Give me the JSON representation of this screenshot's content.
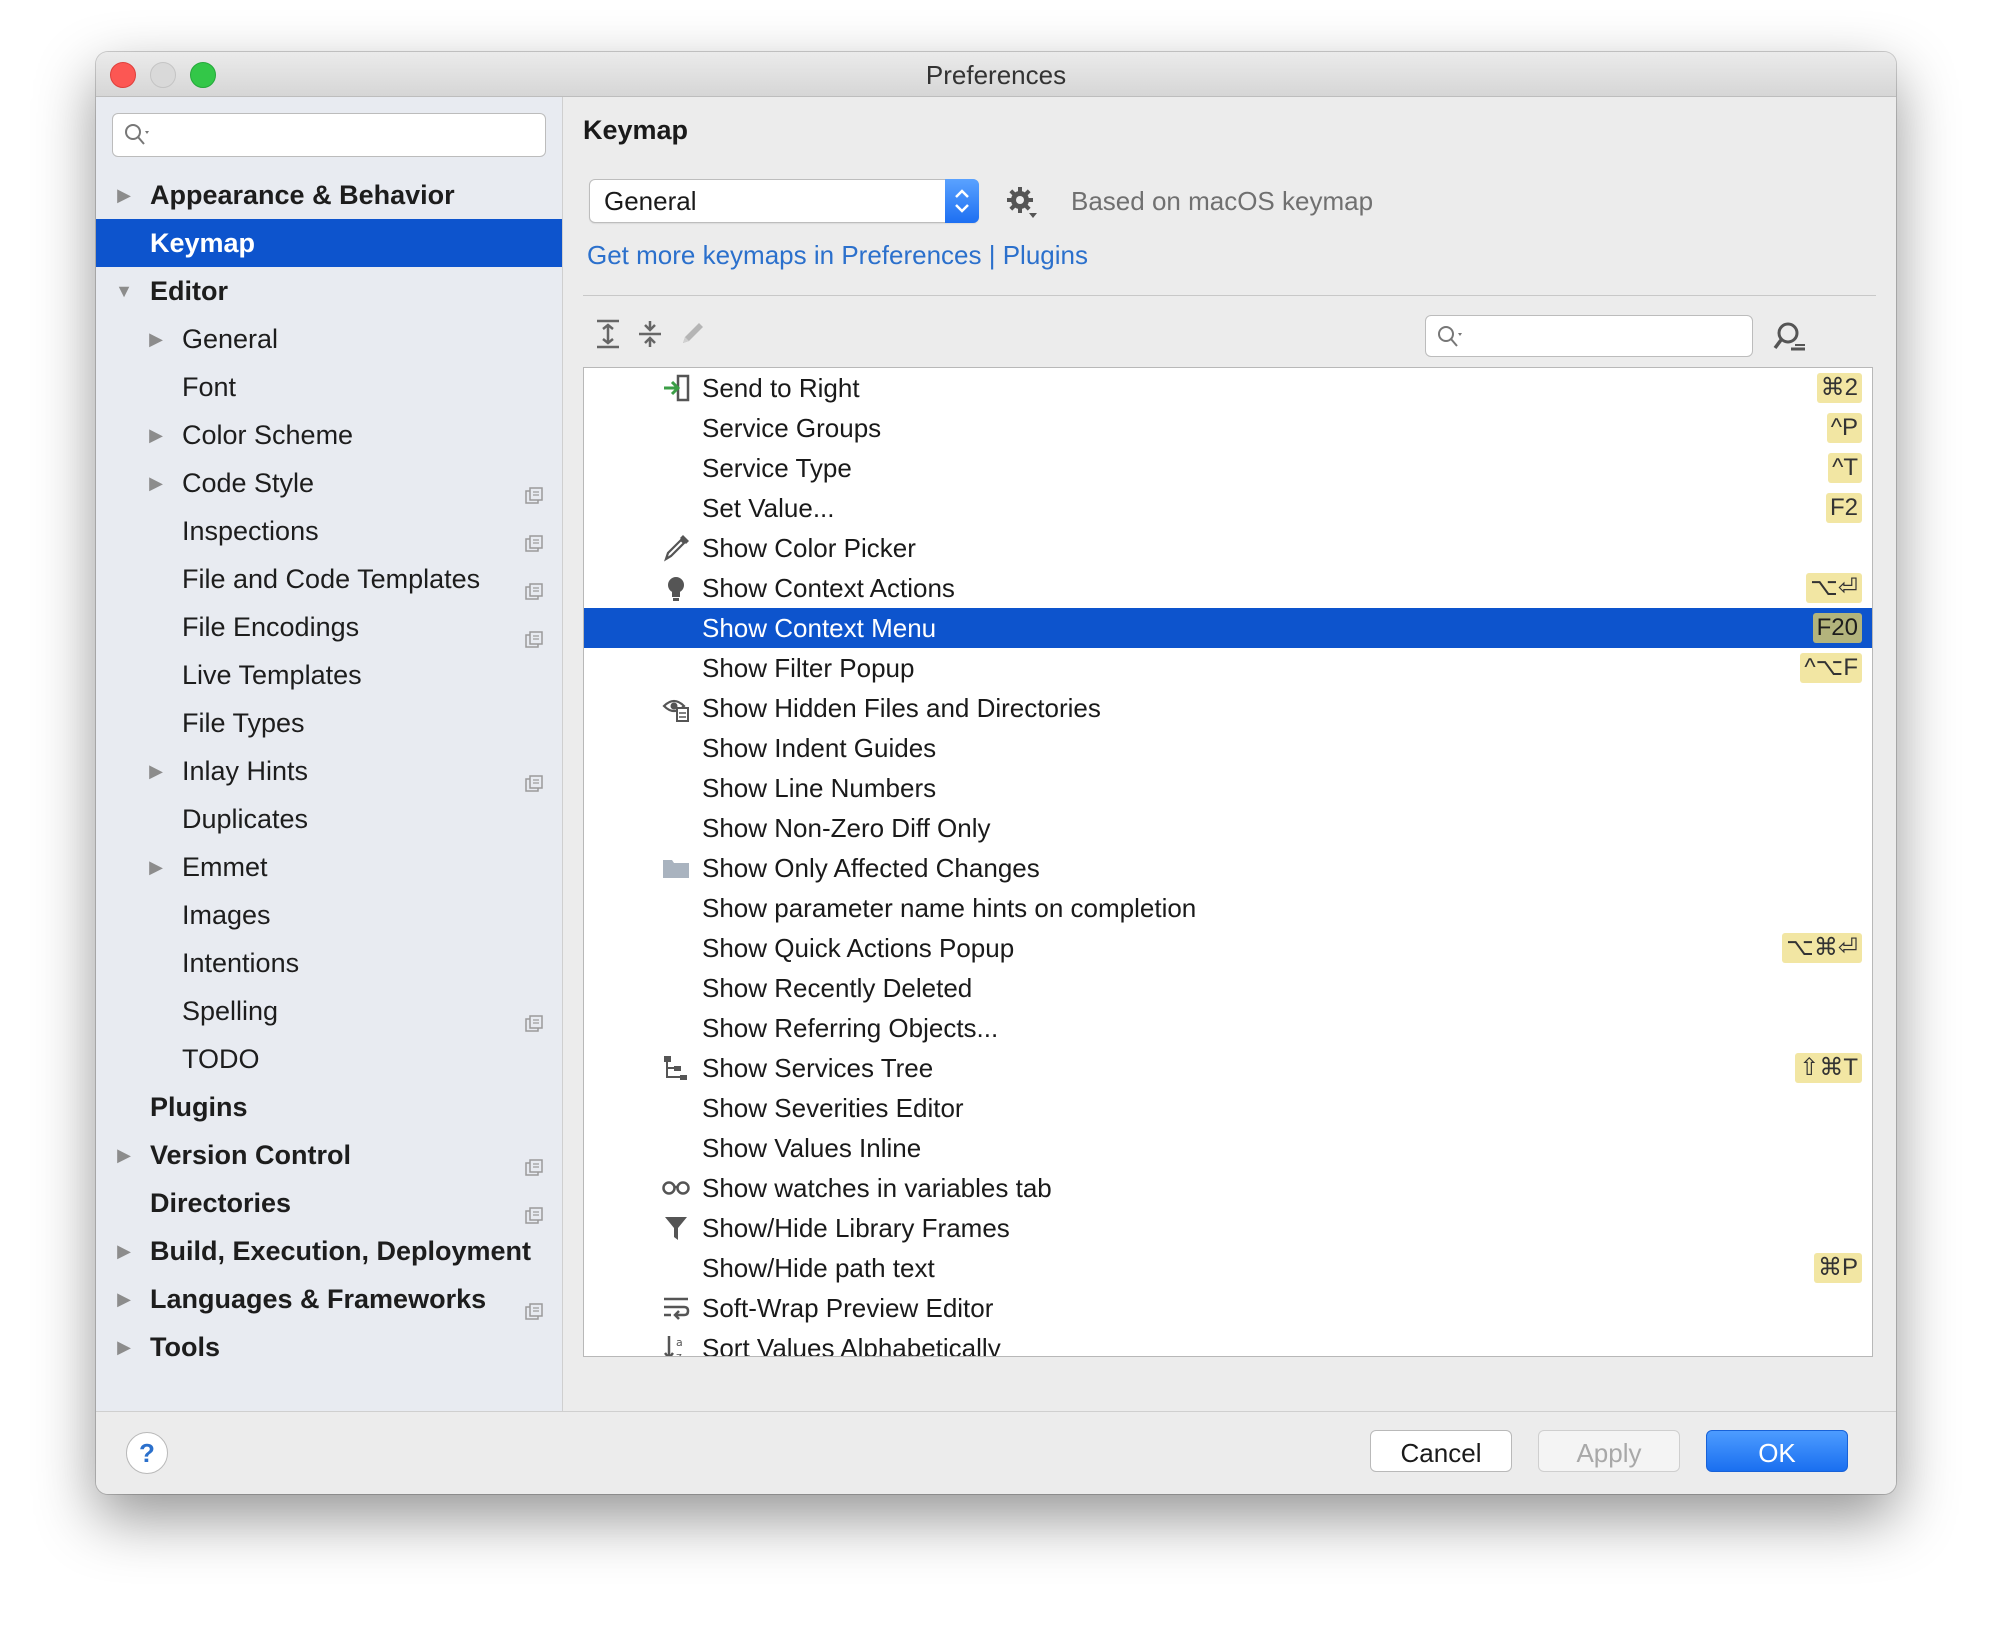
{
  "window": {
    "title": "Preferences"
  },
  "sidebar": {
    "search": {
      "value": "",
      "placeholder": ""
    },
    "items": [
      {
        "label": "Appearance & Behavior",
        "level": 0,
        "bold": true,
        "arrow": "collapsed",
        "selected": false,
        "project_scope": false
      },
      {
        "label": "Keymap",
        "level": 0,
        "bold": true,
        "arrow": "none",
        "selected": true,
        "project_scope": false
      },
      {
        "label": "Editor",
        "level": 0,
        "bold": true,
        "arrow": "expanded",
        "selected": false,
        "project_scope": false
      },
      {
        "label": "General",
        "level": 1,
        "bold": false,
        "arrow": "collapsed",
        "selected": false,
        "project_scope": false
      },
      {
        "label": "Font",
        "level": 1,
        "bold": false,
        "arrow": "none",
        "selected": false,
        "project_scope": false
      },
      {
        "label": "Color Scheme",
        "level": 1,
        "bold": false,
        "arrow": "collapsed",
        "selected": false,
        "project_scope": false
      },
      {
        "label": "Code Style",
        "level": 1,
        "bold": false,
        "arrow": "collapsed",
        "selected": false,
        "project_scope": true
      },
      {
        "label": "Inspections",
        "level": 1,
        "bold": false,
        "arrow": "none",
        "selected": false,
        "project_scope": true
      },
      {
        "label": "File and Code Templates",
        "level": 1,
        "bold": false,
        "arrow": "none",
        "selected": false,
        "project_scope": true
      },
      {
        "label": "File Encodings",
        "level": 1,
        "bold": false,
        "arrow": "none",
        "selected": false,
        "project_scope": true
      },
      {
        "label": "Live Templates",
        "level": 1,
        "bold": false,
        "arrow": "none",
        "selected": false,
        "project_scope": false
      },
      {
        "label": "File Types",
        "level": 1,
        "bold": false,
        "arrow": "none",
        "selected": false,
        "project_scope": false
      },
      {
        "label": "Inlay Hints",
        "level": 1,
        "bold": false,
        "arrow": "collapsed",
        "selected": false,
        "project_scope": true
      },
      {
        "label": "Duplicates",
        "level": 1,
        "bold": false,
        "arrow": "none",
        "selected": false,
        "project_scope": false
      },
      {
        "label": "Emmet",
        "level": 1,
        "bold": false,
        "arrow": "collapsed",
        "selected": false,
        "project_scope": false
      },
      {
        "label": "Images",
        "level": 1,
        "bold": false,
        "arrow": "none",
        "selected": false,
        "project_scope": false
      },
      {
        "label": "Intentions",
        "level": 1,
        "bold": false,
        "arrow": "none",
        "selected": false,
        "project_scope": false
      },
      {
        "label": "Spelling",
        "level": 1,
        "bold": false,
        "arrow": "none",
        "selected": false,
        "project_scope": true
      },
      {
        "label": "TODO",
        "level": 1,
        "bold": false,
        "arrow": "none",
        "selected": false,
        "project_scope": false
      },
      {
        "label": "Plugins",
        "level": 0,
        "bold": true,
        "arrow": "none",
        "selected": false,
        "project_scope": false
      },
      {
        "label": "Version Control",
        "level": 0,
        "bold": true,
        "arrow": "collapsed",
        "selected": false,
        "project_scope": true
      },
      {
        "label": "Directories",
        "level": 0,
        "bold": true,
        "arrow": "none",
        "selected": false,
        "project_scope": true
      },
      {
        "label": "Build, Execution, Deployment",
        "level": 0,
        "bold": true,
        "arrow": "collapsed",
        "selected": false,
        "project_scope": false
      },
      {
        "label": "Languages & Frameworks",
        "level": 0,
        "bold": true,
        "arrow": "collapsed",
        "selected": false,
        "project_scope": true
      },
      {
        "label": "Tools",
        "level": 0,
        "bold": true,
        "arrow": "collapsed",
        "selected": false,
        "project_scope": false
      }
    ]
  },
  "main": {
    "heading": "Keymap",
    "keymap_select": {
      "value": "General"
    },
    "based_on": "Based on macOS keymap",
    "get_more": {
      "prefix": "Get more keymaps in ",
      "link1": "Preferences",
      "separator": " | ",
      "link2": "Plugins"
    },
    "action_search": {
      "value": "",
      "placeholder": ""
    },
    "actions": [
      {
        "label": "Send to Right",
        "icon": "send-right-icon",
        "shortcut": "⌘2",
        "selected": false
      },
      {
        "label": "Service Groups",
        "icon": "",
        "shortcut": "^P",
        "selected": false
      },
      {
        "label": "Service Type",
        "icon": "",
        "shortcut": "^T",
        "selected": false
      },
      {
        "label": "Set Value...",
        "icon": "",
        "shortcut": "F2",
        "selected": false
      },
      {
        "label": "Show Color Picker",
        "icon": "color-picker-icon",
        "shortcut": "",
        "selected": false
      },
      {
        "label": "Show Context Actions",
        "icon": "lightbulb-icon",
        "shortcut": "⌥⏎",
        "selected": false
      },
      {
        "label": "Show Context Menu",
        "icon": "",
        "shortcut": "F20",
        "selected": true
      },
      {
        "label": "Show Filter Popup",
        "icon": "",
        "shortcut": "^⌥F",
        "selected": false
      },
      {
        "label": "Show Hidden Files and Directories",
        "icon": "hidden-files-icon",
        "shortcut": "",
        "selected": false
      },
      {
        "label": "Show Indent Guides",
        "icon": "",
        "shortcut": "",
        "selected": false
      },
      {
        "label": "Show Line Numbers",
        "icon": "",
        "shortcut": "",
        "selected": false
      },
      {
        "label": "Show Non-Zero Diff Only",
        "icon": "",
        "shortcut": "",
        "selected": false
      },
      {
        "label": "Show Only Affected Changes",
        "icon": "folder-icon",
        "shortcut": "",
        "selected": false
      },
      {
        "label": "Show parameter name hints on completion",
        "icon": "",
        "shortcut": "",
        "selected": false
      },
      {
        "label": "Show Quick Actions Popup",
        "icon": "",
        "shortcut": "⌥⌘⏎",
        "selected": false
      },
      {
        "label": "Show Recently Deleted",
        "icon": "",
        "shortcut": "",
        "selected": false
      },
      {
        "label": "Show Referring Objects...",
        "icon": "",
        "shortcut": "",
        "selected": false
      },
      {
        "label": "Show Services Tree",
        "icon": "tree-icon",
        "shortcut": "⇧⌘T",
        "selected": false
      },
      {
        "label": "Show Severities Editor",
        "icon": "",
        "shortcut": "",
        "selected": false
      },
      {
        "label": "Show Values Inline",
        "icon": "",
        "shortcut": "",
        "selected": false
      },
      {
        "label": "Show watches in variables tab",
        "icon": "glasses-icon",
        "shortcut": "",
        "selected": false
      },
      {
        "label": "Show/Hide Library Frames",
        "icon": "filter-icon",
        "shortcut": "",
        "selected": false
      },
      {
        "label": "Show/Hide path text",
        "icon": "",
        "shortcut": "⌘P",
        "selected": false
      },
      {
        "label": "Soft-Wrap Preview Editor",
        "icon": "soft-wrap-icon",
        "shortcut": "",
        "selected": false
      },
      {
        "label": "Sort Values Alphabetically",
        "icon": "sort-alpha-icon",
        "shortcut": "",
        "selected": false
      }
    ]
  },
  "footer": {
    "help": "?",
    "cancel": "Cancel",
    "apply": "Apply",
    "ok": "OK"
  },
  "colors": {
    "selection": "#0d54cd",
    "link": "#2b70cc",
    "shortcut_bg": "#f2e6a3",
    "ok_button": "#1a6ff0"
  }
}
